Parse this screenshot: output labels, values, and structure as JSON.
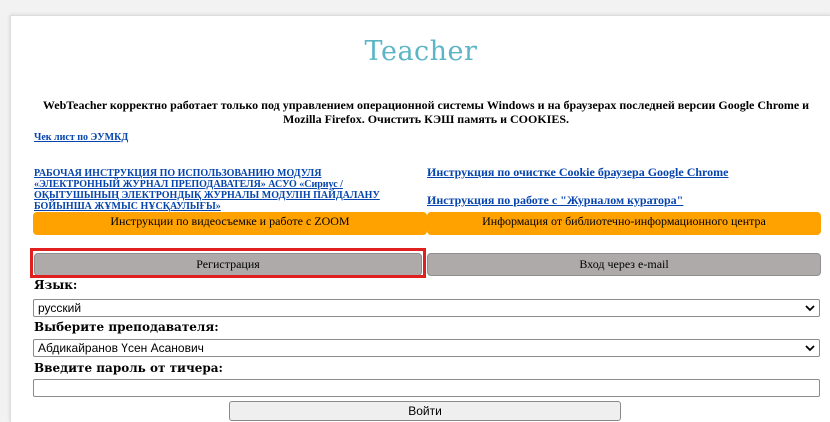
{
  "page": {
    "title": "Teacher",
    "notice": "WebTeacher корректно работает только под управлением операционной системы Windows и на браузерах последней версии Google Chrome и Mozilla Firefox. Очистить КЭШ память и COOKIES."
  },
  "links": {
    "checklist": "Чек лист по ЭУМКД",
    "manual": "РАБОЧАЯ ИНСТРУКЦИЯ ПО ИСПОЛЬЗОВАНИЮ МОДУЛЯ «ЭЛЕКТРОННЫЙ ЖУРНАЛ ПРЕПОДАВАТЕЛЯ» АСУО «Сириус / ОҚЫТУШЫНЫҢ ЭЛЕКТРОНДЫҚ ЖУРНАЛЫ МОДУЛІН ПАЙДАЛАНУ БОЙЫНША ЖҰМЫС НҰСҚАУЛЫҒЫ»",
    "cookie": "Инструкция по очистке Cookie браузера Google Chrome",
    "curator": "Инструкция по работе с \"Журналом куратора\""
  },
  "buttons": {
    "zoom": "Инструкции по видеосъемке и работе с ZOOM",
    "library": "Информация от библиотечно-информационного центра",
    "registration": "Регистрация",
    "email_login": "Вход через e-mail",
    "login": "Войти"
  },
  "form": {
    "language_label": "Язык:",
    "language_value": "русский",
    "teacher_label": "Выберите преподавателя:",
    "teacher_value": "Абдикайранов Үсен Асанович",
    "password_label": "Введите пароль от тичера:",
    "password_value": ""
  },
  "icons": {
    "dropdown": "chevron-down-icon"
  },
  "colors": {
    "title": "#5bb5c6",
    "orange": "#ffa200",
    "gray": "#aeaaaa",
    "highlight": "#e0201e",
    "link": "#0645ad"
  }
}
